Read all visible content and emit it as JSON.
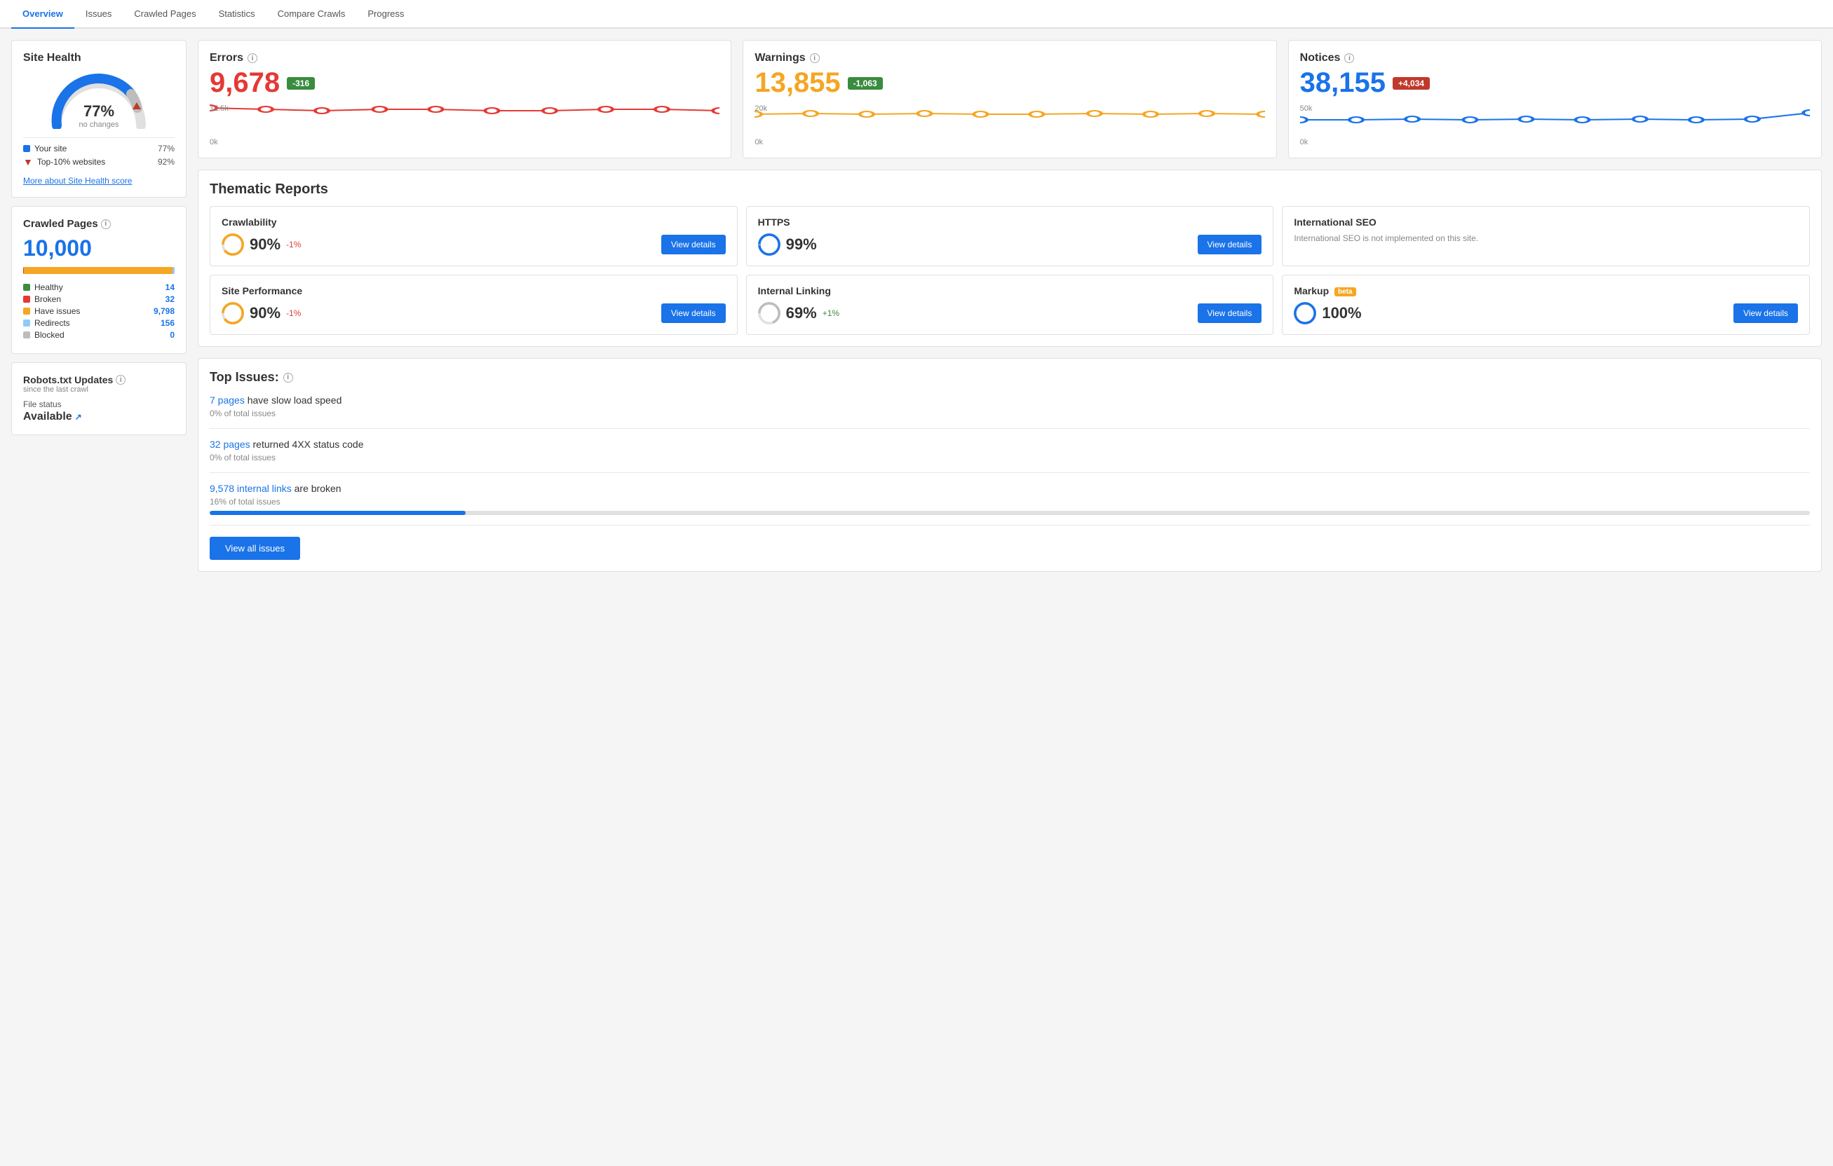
{
  "tabs": [
    {
      "label": "Overview",
      "active": true
    },
    {
      "label": "Issues",
      "active": false
    },
    {
      "label": "Crawled Pages",
      "active": false
    },
    {
      "label": "Statistics",
      "active": false
    },
    {
      "label": "Compare Crawls",
      "active": false
    },
    {
      "label": "Progress",
      "active": false
    }
  ],
  "site_health": {
    "title": "Site Health",
    "pct": 77,
    "pct_label": "77%",
    "sub_label": "no changes",
    "legend": [
      {
        "label": "Your site",
        "val": "77%",
        "type": "blue"
      },
      {
        "label": "Top-10% websites",
        "val": "92%",
        "type": "red-arrow"
      }
    ],
    "more_link": "More about Site Health score"
  },
  "crawled_pages": {
    "title": "Crawled Pages",
    "count": "10,000",
    "segments": [
      {
        "color": "#3a8c3f",
        "pct": 0.14
      },
      {
        "color": "#e53935",
        "pct": 0.32
      },
      {
        "color": "#f5a623",
        "pct": 97.98
      },
      {
        "color": "#90caf9",
        "pct": 1.56
      },
      {
        "color": "#bdbdbd",
        "pct": 0.0
      }
    ],
    "stats": [
      {
        "label": "Healthy",
        "val": "14",
        "color": "#3a8c3f"
      },
      {
        "label": "Broken",
        "val": "32",
        "color": "#e53935"
      },
      {
        "label": "Have issues",
        "val": "9,798",
        "color": "#f5a623"
      },
      {
        "label": "Redirects",
        "val": "156",
        "color": "#90caf9"
      },
      {
        "label": "Blocked",
        "val": "0",
        "color": "#bdbdbd"
      }
    ]
  },
  "robots": {
    "title": "Robots.txt Updates",
    "subtitle": "since the last crawl",
    "file_status_label": "File status",
    "file_status_val": "Available"
  },
  "metrics": [
    {
      "label": "Errors",
      "value": "9,678",
      "color": "red",
      "badge": "-316",
      "badge_type": "green",
      "chart_top": "12.5k",
      "chart_bot": "0k",
      "points": [
        0.9,
        0.88,
        0.87,
        0.88,
        0.88,
        0.87,
        0.87,
        0.88,
        0.88,
        0.87
      ],
      "stroke": "#e53935"
    },
    {
      "label": "Warnings",
      "value": "13,855",
      "color": "orange",
      "badge": "-1,063",
      "badge_type": "green",
      "chart_top": "20k",
      "chart_bot": "0k",
      "points": [
        0.72,
        0.73,
        0.72,
        0.73,
        0.72,
        0.72,
        0.73,
        0.72,
        0.73,
        0.72
      ],
      "stroke": "#f5a623"
    },
    {
      "label": "Notices",
      "value": "38,155",
      "color": "blue",
      "badge": "+4,034",
      "badge_type": "red",
      "chart_top": "50k",
      "chart_bot": "0k",
      "points": [
        0.55,
        0.55,
        0.56,
        0.55,
        0.56,
        0.55,
        0.56,
        0.55,
        0.56,
        0.62
      ],
      "stroke": "#1a73e8"
    }
  ],
  "thematic_reports": {
    "title": "Thematic Reports",
    "items": [
      {
        "title": "Crawlability",
        "pct": "90%",
        "change": "-1%",
        "change_type": "neg",
        "has_button": true,
        "btn_label": "View details",
        "donut_pct": 90,
        "donut_color": "#f5a623"
      },
      {
        "title": "HTTPS",
        "pct": "99%",
        "change": "",
        "change_type": "",
        "has_button": true,
        "btn_label": "View details",
        "donut_pct": 99,
        "donut_color": "#1a73e8"
      },
      {
        "title": "International SEO",
        "pct": "",
        "change": "",
        "change_type": "",
        "has_button": false,
        "btn_label": "",
        "note": "International SEO is not implemented on this site.",
        "donut_pct": 0,
        "donut_color": "#e0e0e0"
      },
      {
        "title": "Site Performance",
        "pct": "90%",
        "change": "-1%",
        "change_type": "neg",
        "has_button": true,
        "btn_label": "View details",
        "donut_pct": 90,
        "donut_color": "#f5a623"
      },
      {
        "title": "Internal Linking",
        "pct": "69%",
        "change": "+1%",
        "change_type": "pos",
        "has_button": true,
        "btn_label": "View details",
        "donut_pct": 69,
        "donut_color": "#e0e0e0"
      },
      {
        "title": "Markup",
        "beta": true,
        "pct": "100%",
        "change": "",
        "change_type": "",
        "has_button": true,
        "btn_label": "View details",
        "donut_pct": 100,
        "donut_color": "#1a73e8"
      }
    ]
  },
  "top_issues": {
    "title": "Top Issues:",
    "issues": [
      {
        "link_text": "7 pages",
        "rest": " have slow load speed",
        "subtitle": "0% of total issues",
        "bar_pct": 0
      },
      {
        "link_text": "32 pages",
        "rest": " returned 4XX status code",
        "subtitle": "0% of total issues",
        "bar_pct": 0
      },
      {
        "link_text": "9,578 internal links",
        "rest": " are broken",
        "subtitle": "16% of total issues",
        "bar_pct": 16
      }
    ],
    "view_all_label": "View all issues"
  }
}
